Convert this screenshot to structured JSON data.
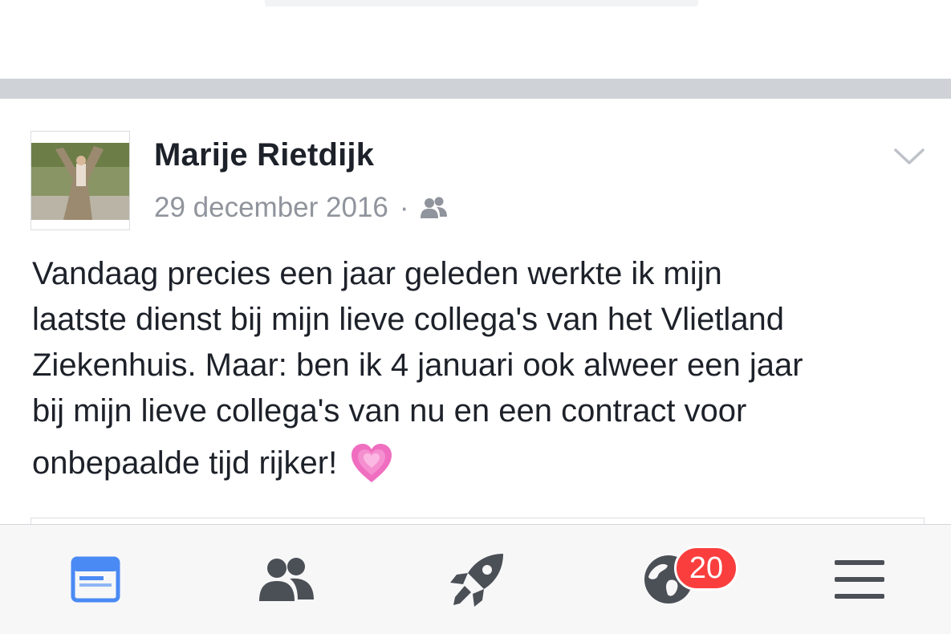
{
  "post": {
    "author": "Marije Rietdijk",
    "date": "29 december 2016",
    "separator": "·",
    "audience_icon": "friends-icon",
    "options_icon": "chevron-down-icon",
    "text_lines": [
      "Vandaag precies een jaar geleden werkte ik mijn",
      "laatste dienst bij mijn lieve collega's van het Vlietland",
      "Ziekenhuis. Maar: ben ik 4 januari ook alweer een jaar",
      "bij mijn lieve collega's van nu en een contract voor",
      "onbepaalde tijd rijker!"
    ],
    "emoji": "growing-heart-emoji"
  },
  "tabbar": {
    "tabs": [
      {
        "name": "news-feed",
        "icon": "news-feed-icon",
        "active": true
      },
      {
        "name": "friend-requests",
        "icon": "friends-icon",
        "active": false
      },
      {
        "name": "explore",
        "icon": "rocket-icon",
        "active": false
      },
      {
        "name": "notifications",
        "icon": "globe-icon",
        "active": false,
        "badge": "20"
      },
      {
        "name": "more",
        "icon": "menu-icon",
        "active": false
      }
    ],
    "notifications_badge": "20"
  },
  "colors": {
    "active_blue": "#4a8af4",
    "icon_gray": "#4b4f56",
    "badge_red": "#fa3e3e",
    "meta_gray": "#90949c",
    "separator_gray": "#cfd2d6"
  }
}
